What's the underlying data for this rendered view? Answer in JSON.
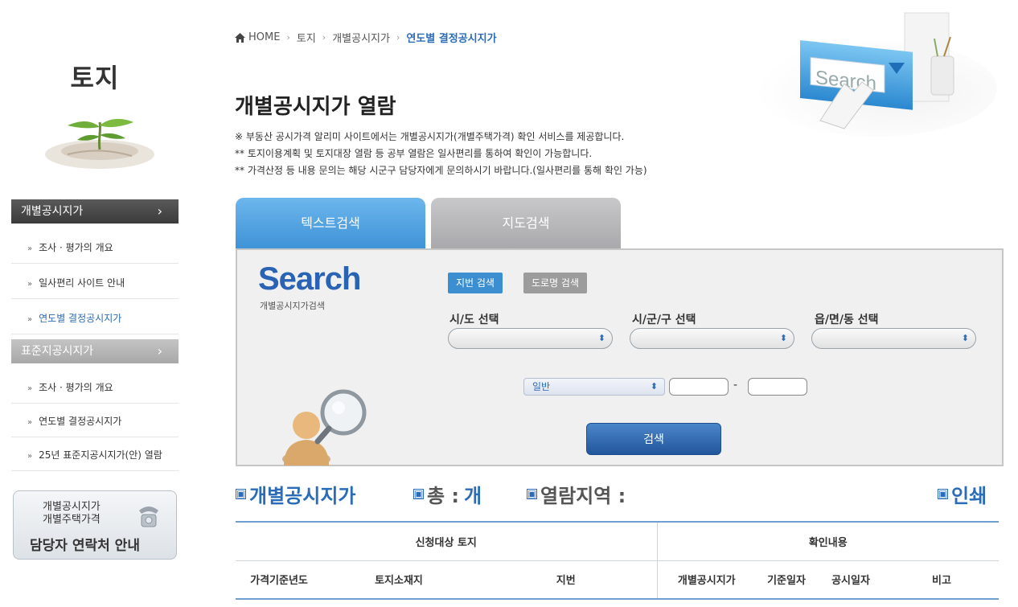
{
  "sidebar": {
    "title": "토지",
    "section1": {
      "label": "개별공시지가",
      "arrow": "›"
    },
    "section1_items": [
      {
        "label": "조사 · 평가의 개요",
        "active": false
      },
      {
        "label": "일사편리 사이트 안내",
        "active": false
      },
      {
        "label": "연도별 결정공시지가",
        "active": true
      }
    ],
    "section2": {
      "label": "표준지공시지가",
      "arrow": "›"
    },
    "section2_items": [
      {
        "label": "조사 · 평가의 개요"
      },
      {
        "label": "연도별 결정공시지가"
      },
      {
        "label": "25년 표준지공시지가(안) 열람"
      }
    ],
    "contact": {
      "line1": "개별공시지가",
      "line2": "개별주택가격",
      "line3": "담당자 연락처 안내"
    },
    "bullet": "»"
  },
  "breadcrumb": {
    "home": "HOME",
    "sep": "›",
    "c1": "토지",
    "c2": "개별공시지가",
    "current": "연도별 결정공시지가"
  },
  "page": {
    "title": "개별공시지가 열람",
    "notes": [
      "※ 부동산 공시가격 알리미 사이트에서는 개별공시지가(개별주택가격) 확인 서비스를 제공합니다.",
      "** 토지이용계획 및 토지대장 열람 등 공부 열람은 일사편리를 통하여 확인이 가능합니다.",
      "** 가격산정 등 내용 문의는 해당 시군구 담당자에게 문의하시기 바랍니다.(일사편리를 통해 확인 가능)"
    ],
    "hero_text": "Search"
  },
  "tabs": {
    "text_search": "텍스트검색",
    "map_search": "지도검색"
  },
  "search_panel": {
    "logo": "Search",
    "subtitle": "개별공시지가검색",
    "jibun_btn": "지번 검색",
    "road_btn": "도로명 검색",
    "sido_label": "시/도 선택",
    "sigungu_label": "시/군/구 선택",
    "eupmyeondong_label": "읍/면/동 선택",
    "lot_type_value": "일반",
    "dash": "-",
    "search_btn": "검색",
    "chevron": "⬍"
  },
  "results": {
    "section": "개별공시지가",
    "total_label": "총 :",
    "total_value": "개",
    "region_label": "열람지역 :",
    "print": "인쇄",
    "box": "▣"
  },
  "table": {
    "group1": "신청대상 토지",
    "group2": "확인내용",
    "columns": [
      "가격기준년도",
      "토지소재지",
      "지번",
      "개별공시지가",
      "기준일자",
      "공시일자",
      "비고"
    ]
  },
  "colors": {
    "accent": "#2a6cb8",
    "tab_active": "#3f93d8",
    "tab_inactive": "#a9a9ac"
  }
}
